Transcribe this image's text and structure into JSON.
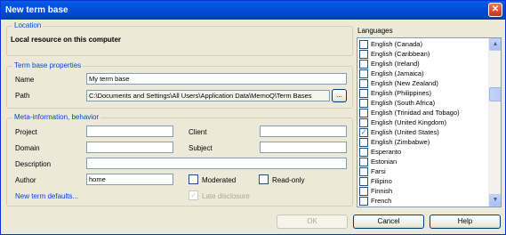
{
  "window": {
    "title": "New term base"
  },
  "location": {
    "legend": "Location",
    "text": "Local resource on this computer"
  },
  "properties": {
    "legend": "Term base properties",
    "name_label": "Name",
    "name_value": "My term base",
    "path_label": "Path",
    "path_value": "C:\\Documents and Settings\\All Users\\Application Data\\MemoQ\\Term Bases",
    "browse_label": "..."
  },
  "meta": {
    "legend": "Meta-information, behavior",
    "project_label": "Project",
    "project_value": "",
    "client_label": "Client",
    "client_value": "",
    "domain_label": "Domain",
    "domain_value": "",
    "subject_label": "Subject",
    "subject_value": "",
    "description_label": "Description",
    "description_value": "",
    "author_label": "Author",
    "author_value": "home",
    "moderated_label": "Moderated",
    "readonly_label": "Read-only",
    "late_disclosure_label": "Late disclosure",
    "defaults_link": "New term defaults..."
  },
  "languages": {
    "label": "Languages",
    "items": [
      {
        "name": "English (Canada)",
        "checked": false
      },
      {
        "name": "English (Caribbean)",
        "checked": false
      },
      {
        "name": "English (Ireland)",
        "checked": false
      },
      {
        "name": "English (Jamaica)",
        "checked": false
      },
      {
        "name": "English (New Zealand)",
        "checked": false
      },
      {
        "name": "English (Philippines)",
        "checked": false
      },
      {
        "name": "English (South Africa)",
        "checked": false
      },
      {
        "name": "English (Trinidad and Tobago)",
        "checked": false
      },
      {
        "name": "English (United Kingdom)",
        "checked": false
      },
      {
        "name": "English (United States)",
        "checked": true
      },
      {
        "name": "English (Zimbabwe)",
        "checked": false
      },
      {
        "name": "Esperanto",
        "checked": false
      },
      {
        "name": "Estonian",
        "checked": false
      },
      {
        "name": "Farsi",
        "checked": false
      },
      {
        "name": "Filipino",
        "checked": false
      },
      {
        "name": "Finnish",
        "checked": false
      },
      {
        "name": "French",
        "checked": false
      }
    ]
  },
  "buttons": {
    "ok": "OK",
    "cancel": "Cancel",
    "help": "Help"
  }
}
